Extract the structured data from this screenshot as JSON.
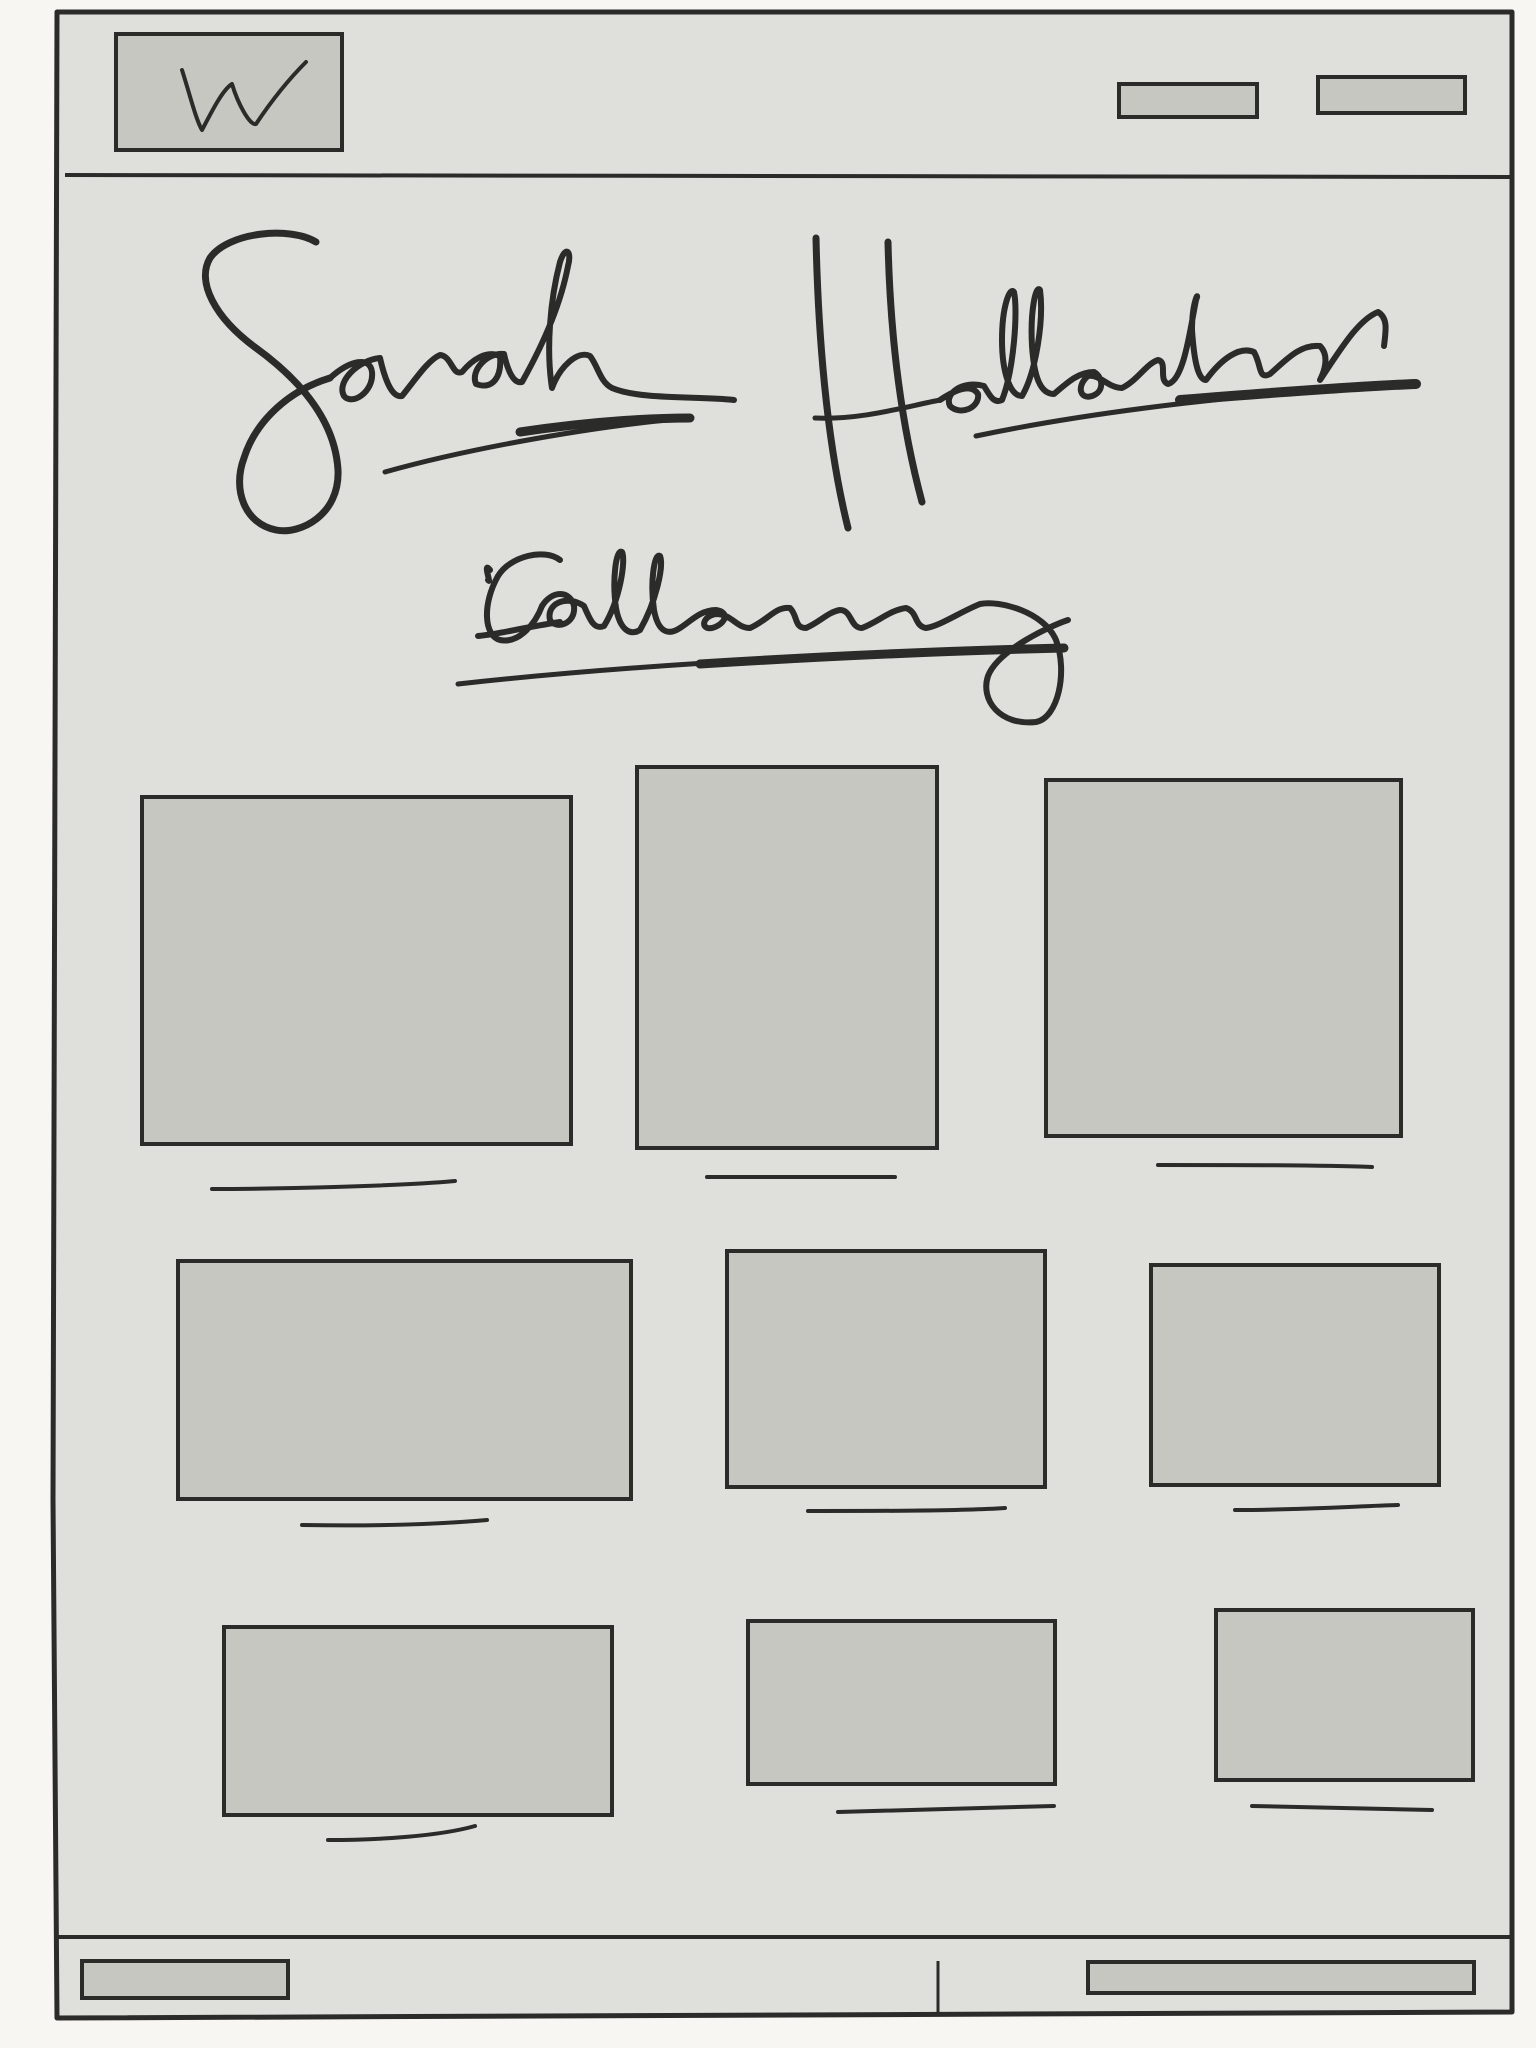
{
  "header": {
    "logo_letter": "W"
  },
  "title": {
    "name": "Sarah Hallachen",
    "subtitle": "Gallery"
  },
  "colors": {
    "paper": "#f7f6f2",
    "frame_fill": "#dfdfdc",
    "placeholder_fill": "#c6c7c1",
    "ink": "#2b2b29"
  },
  "gallery": {
    "rows": 3,
    "columns": 3,
    "tiles": [
      {
        "caption": ""
      },
      {
        "caption": ""
      },
      {
        "caption": ""
      },
      {
        "caption": ""
      },
      {
        "caption": ""
      },
      {
        "caption": ""
      },
      {
        "caption": ""
      },
      {
        "caption": ""
      },
      {
        "caption": ""
      }
    ]
  }
}
